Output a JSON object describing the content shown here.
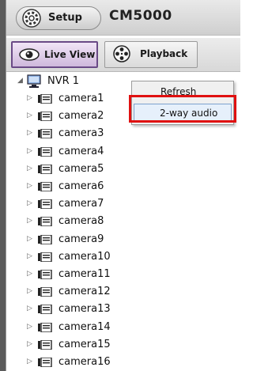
{
  "header": {
    "setup_label": "Setup",
    "app_title": "CM5000"
  },
  "tabs": [
    {
      "label": "Live View",
      "active": true
    },
    {
      "label": "Playback",
      "active": false
    }
  ],
  "tree": {
    "root": {
      "label": "NVR 1",
      "expanded": true
    },
    "cameras": [
      "camera1",
      "camera2",
      "camera3",
      "camera4",
      "camera5",
      "camera6",
      "camera7",
      "camera8",
      "camera9",
      "camera10",
      "camera11",
      "camera12",
      "camera13",
      "camera14",
      "camera15",
      "camera16"
    ]
  },
  "context_menu": {
    "items": [
      {
        "label": "Refresh"
      },
      {
        "label": "2-way audio"
      }
    ]
  },
  "colors": {
    "highlight": "#e01010",
    "active_tab": "#6a4a86"
  },
  "icons": {
    "setup": "gear-icon",
    "live_view": "eye-icon",
    "playback": "film-reel-icon",
    "nvr": "monitor-icon",
    "camera": "camera-icon"
  }
}
